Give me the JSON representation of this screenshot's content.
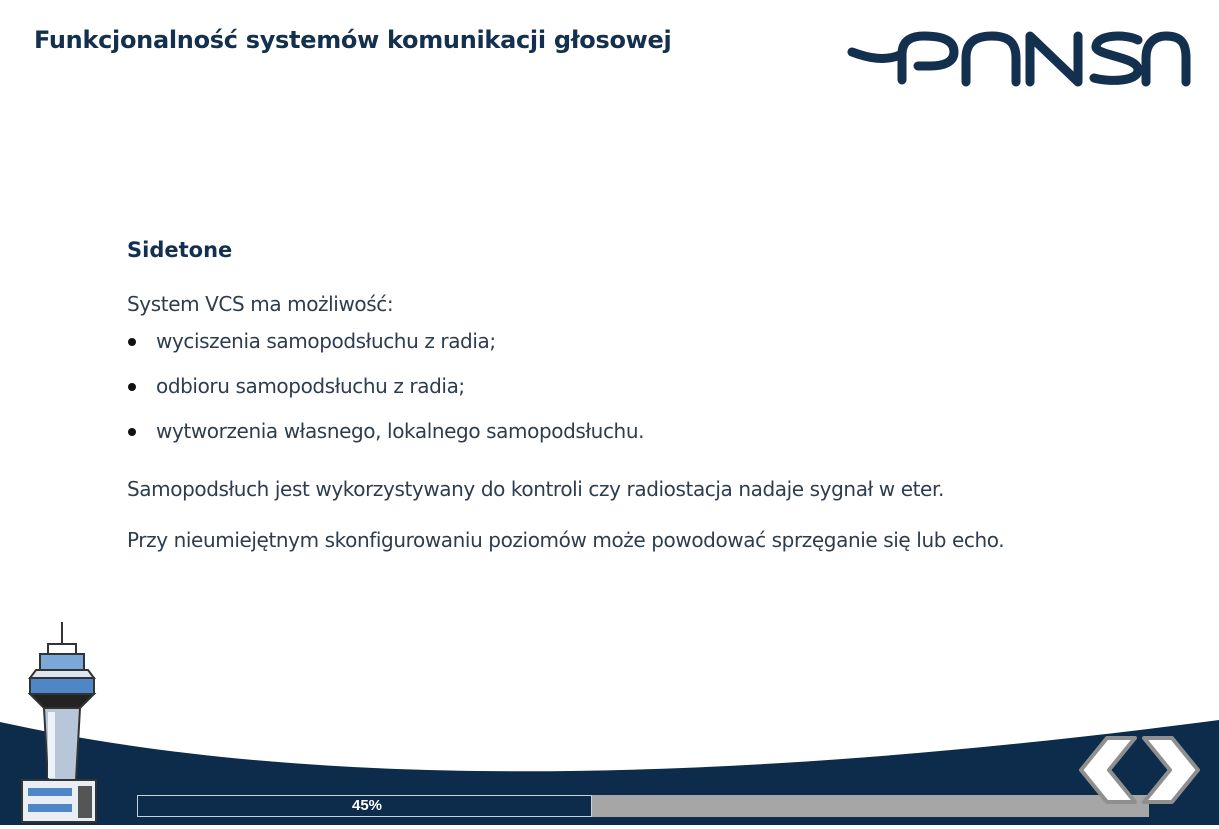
{
  "header": {
    "title": "Funkcjonalność systemów komunikacji głosowej",
    "logo_text": "PANSA",
    "logo_icon": "pansa-logo"
  },
  "content": {
    "heading": "Sidetone",
    "intro": "System VCS ma możliwość:",
    "bullets": [
      "wyciszenia samopodsłuchu z radia;",
      "odbioru samopodsłuchu z radia;",
      "wytworzenia własnego, lokalnego samopodsłuchu."
    ],
    "paragraph1": "Samopodsłuch jest wykorzystywany do kontroli czy radiostacja nadaje sygnał w eter.",
    "paragraph2": "Przy nieumiejętnym skonfigurowaniu poziomów może powodować sprzęganie się lub echo."
  },
  "footer": {
    "progress": {
      "label": "45%",
      "value": 0.45
    },
    "prev_icon": "chevron-left-icon",
    "next_icon": "chevron-right-icon",
    "illustration": "control-tower-icon"
  },
  "colors": {
    "navy": "#0d2b4a",
    "title": "#13304f",
    "progress_track": "#a6a6a6",
    "nav_chevron": "#8f8f8f"
  }
}
